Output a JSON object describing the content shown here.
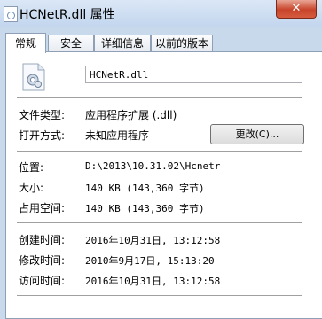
{
  "window": {
    "title": "HCNetR.dll 属性",
    "close_label": "✕"
  },
  "tabs": [
    {
      "label": "常规",
      "active": true
    },
    {
      "label": "安全",
      "active": false
    },
    {
      "label": "详细信息",
      "active": false
    },
    {
      "label": "以前的版本",
      "active": false
    }
  ],
  "general": {
    "file_name": "HCNetR.dll",
    "file_type_label": "文件类型:",
    "file_type_value": "应用程序扩展 (.dll)",
    "open_with_label": "打开方式:",
    "open_with_value": "未知应用程序",
    "change_button": "更改(C)...",
    "location_label": "位置:",
    "location_value": "D:\\2013\\10.31.02\\Hcnetr",
    "size_label": "大小:",
    "size_value": "140 KB (143,360 字节)",
    "size_on_disk_label": "占用空间:",
    "size_on_disk_value": "140 KB (143,360 字节)",
    "created_label": "创建时间:",
    "created_value": "2016年10月31日, 13:12:58",
    "modified_label": "修改时间:",
    "modified_value": "2010年9月17日, 15:13:20",
    "accessed_label": "访问时间:",
    "accessed_value": "2016年10月31日, 13:12:58"
  },
  "icons": {
    "app": "dll-file-icon",
    "file": "dll-gear-file-icon"
  }
}
